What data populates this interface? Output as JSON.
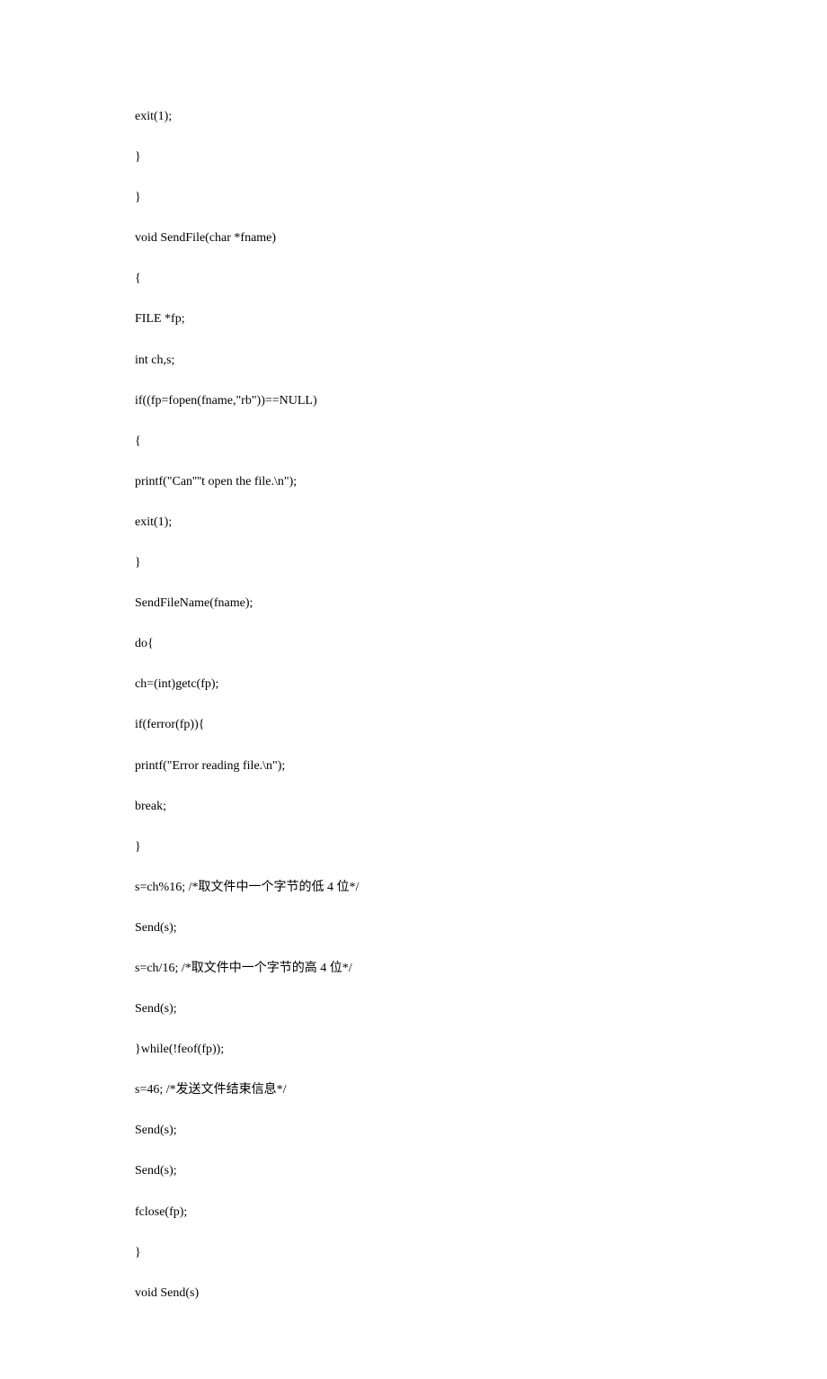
{
  "lines": [
    "exit(1);",
    "}",
    "}",
    "void SendFile(char *fname)",
    "{",
    "FILE *fp;",
    "int ch,s;",
    "if((fp=fopen(fname,\"rb\"))==NULL)",
    "{",
    "printf(\"Can''''t open the file.\\n\");",
    "exit(1);",
    "}",
    "SendFileName(fname);",
    "do{",
    "ch=(int)getc(fp);",
    "if(ferror(fp)){",
    "printf(\"Error reading file.\\n\");",
    "break;",
    "}",
    "s=ch%16; /*取文件中一个字节的低 4 位*/",
    "Send(s);",
    "s=ch/16; /*取文件中一个字节的高 4 位*/",
    "Send(s);",
    "}while(!feof(fp));",
    "s=46; /*发送文件结束信息*/",
    "Send(s);",
    "Send(s);",
    "fclose(fp);",
    "}",
    "void Send(s)"
  ]
}
